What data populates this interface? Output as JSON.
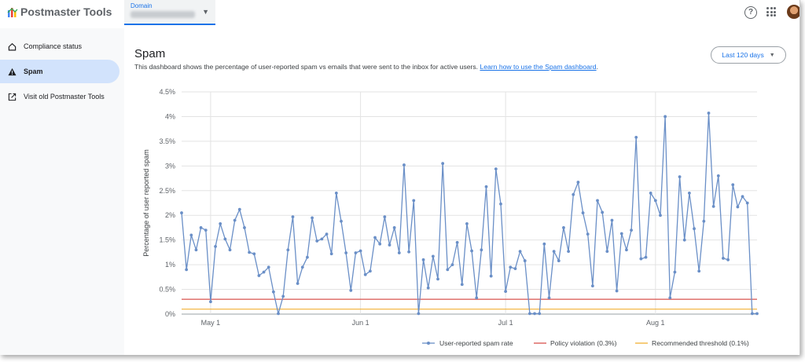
{
  "app": {
    "title": "Postmaster Tools"
  },
  "domain_select": {
    "label": "Domain",
    "value": ""
  },
  "sidebar": {
    "items": [
      {
        "label": "Compliance status",
        "icon": "home-icon",
        "active": false
      },
      {
        "label": "Spam",
        "icon": "warning-icon",
        "active": true
      },
      {
        "label": "Visit old Postmaster Tools",
        "icon": "open-in-new-icon",
        "active": false
      }
    ]
  },
  "page": {
    "title": "Spam",
    "description": "This dashboard shows the percentage of user-reported spam vs emails that were sent to the inbox for active users.",
    "link": "Learn how to use the Spam dashboard",
    "link_suffix": ".",
    "range_label": "Last 120 days"
  },
  "colors": {
    "series": "#6a8fc7",
    "policy": "#d9534f",
    "threshold": "#f2b134",
    "accent": "#1a73e8"
  },
  "chart_data": {
    "type": "line",
    "title": "",
    "xlabel": "",
    "ylabel": "Percentage of user reported spam",
    "ylim": [
      0,
      4.5
    ],
    "y_ticks": [
      "0%",
      "0.5%",
      "1%",
      "1.5%",
      "2%",
      "2.5%",
      "3%",
      "3.5%",
      "4%",
      "4.5%"
    ],
    "x_ticks": [
      {
        "label": "May 1",
        "day": 6
      },
      {
        "label": "Jun 1",
        "day": 37
      },
      {
        "label": "Jul 1",
        "day": 67
      },
      {
        "label": "Aug 1",
        "day": 98
      }
    ],
    "grid": true,
    "legend_position": "bottom-right",
    "series": [
      {
        "name": "User-reported spam rate",
        "x": [
          0,
          1,
          2,
          3,
          4,
          5,
          6,
          7,
          8,
          9,
          10,
          11,
          12,
          13,
          14,
          15,
          16,
          17,
          18,
          19,
          20,
          21,
          22,
          23,
          24,
          25,
          26,
          27,
          28,
          29,
          30,
          31,
          32,
          33,
          34,
          35,
          36,
          37,
          38,
          39,
          40,
          41,
          42,
          43,
          44,
          45,
          46,
          47,
          48,
          49,
          50,
          51,
          52,
          53,
          54,
          55,
          56,
          57,
          58,
          59,
          60,
          61,
          62,
          63,
          64,
          65,
          66,
          67,
          68,
          69,
          70,
          71,
          72,
          73,
          74,
          75,
          76,
          77,
          78,
          79,
          80,
          81,
          82,
          83,
          84,
          85,
          86,
          87,
          88,
          89,
          90,
          91,
          92,
          93,
          94,
          95,
          96,
          97,
          98,
          99,
          100,
          101,
          102,
          103,
          104,
          105,
          106,
          107,
          108,
          109,
          110,
          111,
          112,
          113,
          114,
          115,
          116,
          117,
          118,
          119
        ],
        "values": [
          2.05,
          0.9,
          1.6,
          1.3,
          1.75,
          1.7,
          0.25,
          1.37,
          1.83,
          1.52,
          1.3,
          1.9,
          2.12,
          1.75,
          1.25,
          1.22,
          0.78,
          0.85,
          0.95,
          0.45,
          0.01,
          0.36,
          1.3,
          1.97,
          0.62,
          0.95,
          1.15,
          1.95,
          1.48,
          1.52,
          1.62,
          1.22,
          2.45,
          1.88,
          1.24,
          0.48,
          1.24,
          1.28,
          0.8,
          0.87,
          1.55,
          1.42,
          1.97,
          1.4,
          1.75,
          1.24,
          3.02,
          1.26,
          2.3,
          0.01,
          1.1,
          0.53,
          1.17,
          0.71,
          3.05,
          0.9,
          1.0,
          1.45,
          0.6,
          1.83,
          1.28,
          0.33,
          1.3,
          2.58,
          0.77,
          2.94,
          2.23,
          0.46,
          0.95,
          0.92,
          1.27,
          1.08,
          0.01,
          0.01,
          0.01,
          1.42,
          0.33,
          1.27,
          1.08,
          1.75,
          1.27,
          2.42,
          2.67,
          2.05,
          1.62,
          0.57,
          2.3,
          2.06,
          1.27,
          1.9,
          0.47,
          1.63,
          1.3,
          1.7,
          3.58,
          1.12,
          1.15,
          2.45,
          2.3,
          2.0,
          4.0,
          0.33,
          0.85,
          2.78,
          1.5,
          2.45,
          1.73,
          0.87,
          1.88,
          4.07,
          2.18,
          2.8,
          1.13,
          1.1,
          2.62,
          2.17,
          2.38,
          2.25,
          0.01,
          0.01
        ]
      },
      {
        "name": "Policy violation (0.3%)",
        "constant": 0.3
      },
      {
        "name": "Recommended threshold (0.1%)",
        "constant": 0.1
      }
    ]
  }
}
